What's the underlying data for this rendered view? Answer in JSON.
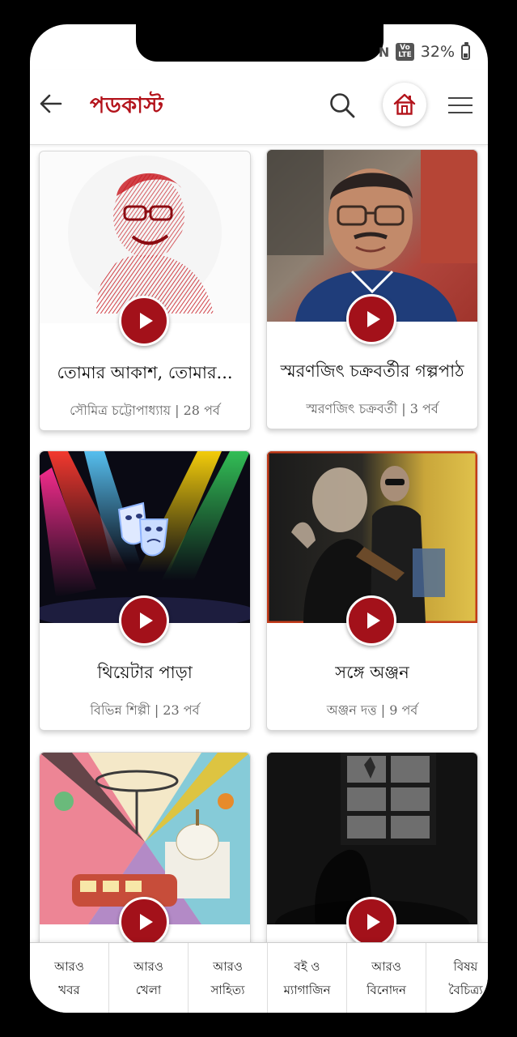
{
  "status_bar": {
    "signal": "N",
    "network_badge": "Vo\nLTE",
    "battery_percent": "32%",
    "battery_level": 0.32
  },
  "header": {
    "title": "পডকাস্ট",
    "accent_color": "#b3131b"
  },
  "podcasts": [
    {
      "title": "তোমার আকাশ, তোমার...",
      "meta": "সৌমিত্র চট্টোপাধ্যায় | 28 পর্ব"
    },
    {
      "title": "স্মরণজিৎ চক্রবর্তীর গল্পপাঠ",
      "meta": "স্মরণজিৎ চক্রবর্তী | 3 পর্ব"
    },
    {
      "title": "থিয়েটার পাড়া",
      "meta": "বিভিন্ন শিল্পী | 23 পর্ব"
    },
    {
      "title": "সঙ্গে অঞ্জন",
      "meta": "অঞ্জন দত্ত | 9 পর্ব"
    },
    {
      "title": "",
      "meta": ""
    },
    {
      "title": "",
      "meta": ""
    }
  ],
  "bottom_nav": [
    {
      "line1": "আরও",
      "line2": "খবর"
    },
    {
      "line1": "আরও",
      "line2": "খেলা"
    },
    {
      "line1": "আরও",
      "line2": "সাহিত্য"
    },
    {
      "line1": "বই ও",
      "line2": "ম্যাগাজিন"
    },
    {
      "line1": "আরও",
      "line2": "বিনোদন"
    },
    {
      "line1": "বিষয়",
      "line2": "বৈচিত্র্য"
    }
  ]
}
